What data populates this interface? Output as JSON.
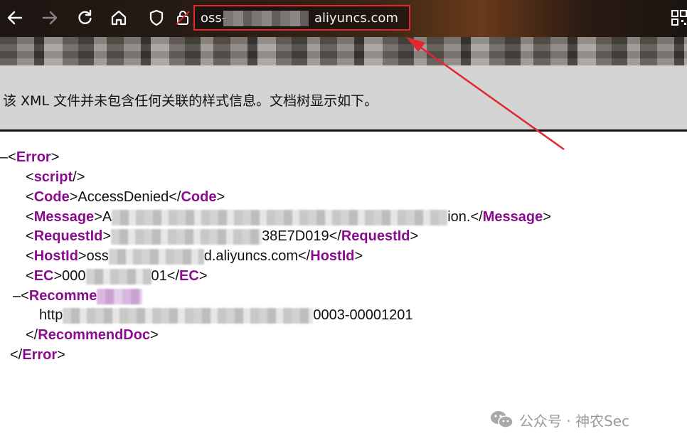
{
  "browser": {
    "url_prefix": "oss-",
    "url_suffix": "aliyuncs.com",
    "icons": {
      "back": "arrow-left-icon",
      "forward": "arrow-right-icon",
      "reload": "reload-icon",
      "home": "home-icon",
      "shield": "shield-icon",
      "lock": "lock-icon",
      "qr": "qr-code-icon"
    }
  },
  "banner": {
    "message": "该 XML 文件并未包含任何关联的样式信息。文档树显示如下。"
  },
  "xml": {
    "collapse_glyph": "–",
    "root_tag": "Error",
    "script_tag": "script",
    "code_tag": "Code",
    "code_value": "AccessDenied",
    "message_tag": "Message",
    "message_start": "A",
    "message_end": "ion.",
    "request_tag": "RequestId",
    "request_end": "38E7D019",
    "host_tag": "HostId",
    "host_start": "oss",
    "host_end": "d.aliyuncs.com",
    "ec_tag": "EC",
    "ec_start": "000",
    "ec_end": "01",
    "recommend_tag": "RecommendDoc",
    "recommend_start": "Recomme",
    "url_start": "http",
    "url_end": "0003-00001201"
  },
  "watermark": {
    "text": "公众号 · 神农Sec",
    "icon": "wechat-icon"
  },
  "colors": {
    "annotation_red": "#e0282e",
    "xml_tag_purple": "#8a0c8f",
    "banner_gray": "#d4d4d4"
  }
}
